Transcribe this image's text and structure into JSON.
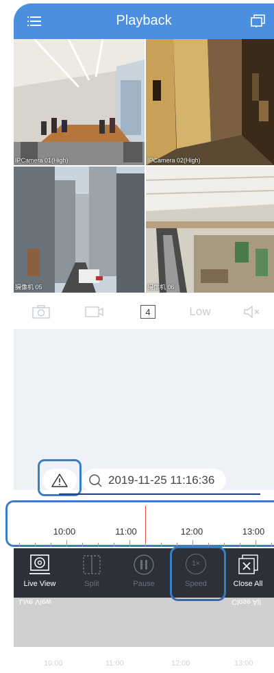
{
  "header": {
    "title": "Playback",
    "menu_icon": "menu-icon",
    "cast_icon": "screen-cast-icon",
    "color": "#4a8fe0"
  },
  "cameras": [
    {
      "caption": "IPCamera 01(High)"
    },
    {
      "caption": "IPCamera 02(High)"
    },
    {
      "caption": "摄像机 05"
    },
    {
      "caption": "摄像机 06"
    }
  ],
  "toolbar": {
    "snapshot_icon": "camera-icon",
    "record_icon": "record-video-icon",
    "split_count": "4",
    "quality": "Low",
    "mute_icon": "speaker-mute-icon"
  },
  "search": {
    "warning_icon": "warning-icon",
    "search_icon": "search-icon",
    "datetime": "2019-11-25 11:16:36"
  },
  "timeline": {
    "labels": [
      "10:00",
      "11:00",
      "12:00",
      "13:00"
    ]
  },
  "bottom_bar": {
    "items": [
      {
        "label": "Live View",
        "enabled": true
      },
      {
        "label": "Split",
        "enabled": false
      },
      {
        "label": "Pause",
        "enabled": false
      },
      {
        "label": "Speed",
        "enabled": false,
        "badge": "1×"
      },
      {
        "label": "Close All",
        "enabled": true
      }
    ]
  },
  "reflection": {
    "labels": [
      "Live View",
      "Close All"
    ],
    "times": [
      "10:00",
      "11:00",
      "12:00",
      "13:00"
    ]
  }
}
